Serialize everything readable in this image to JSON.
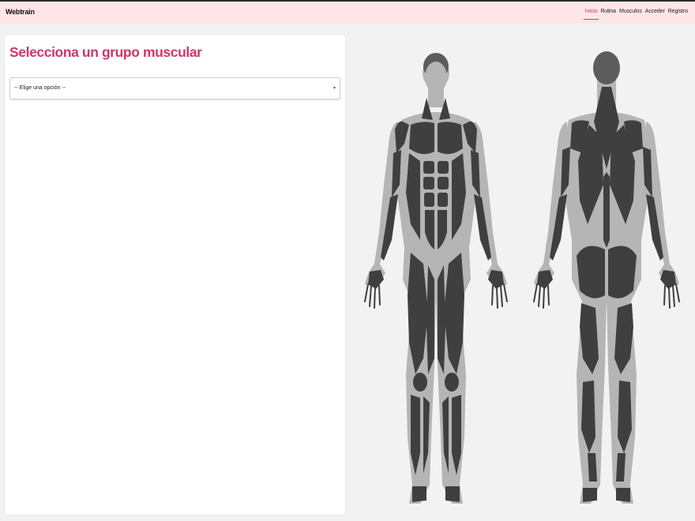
{
  "navbar": {
    "brand": "Webtrain",
    "links": [
      {
        "label": "Inicio",
        "active": true
      },
      {
        "label": "Rutina",
        "active": false
      },
      {
        "label": "Musculos",
        "active": false
      },
      {
        "label": "Acceder",
        "active": false
      },
      {
        "label": "Registro",
        "active": false
      }
    ]
  },
  "main": {
    "title": "Selecciona un grupo muscular",
    "select": {
      "value": "-- Elige una opción --"
    }
  },
  "figures": {
    "front": "body-front-muscles",
    "back": "body-back-muscles"
  },
  "colors": {
    "accent": "#d1356b",
    "navbar_bg": "#fde5e8",
    "page_bg": "#f2f2f2",
    "muscle": "#3f3f3f",
    "skin_outline": "#b5b5b5",
    "head": "#5c5c5c"
  }
}
